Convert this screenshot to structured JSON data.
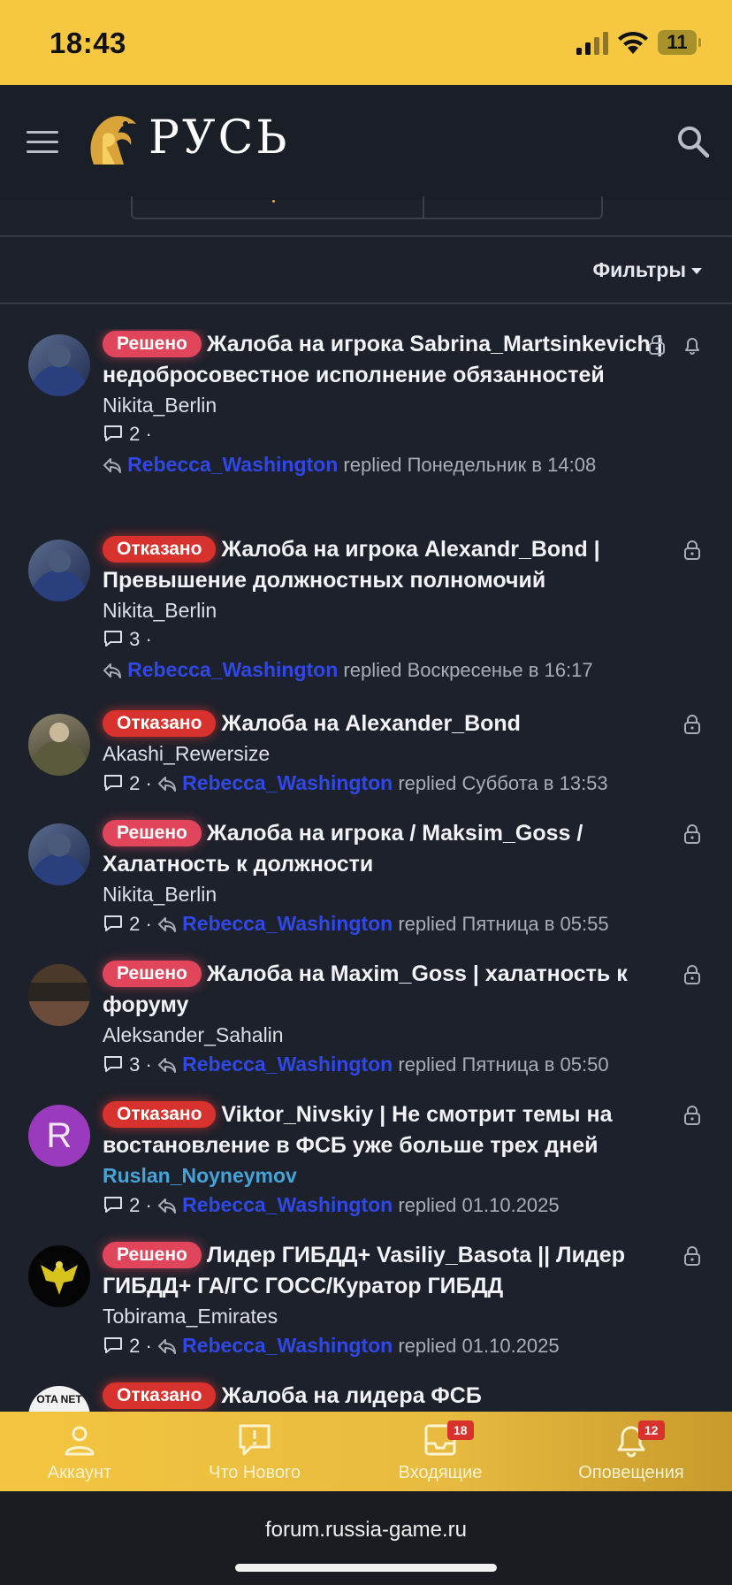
{
  "status_bar": {
    "time": "18:43",
    "battery": "11"
  },
  "header": {
    "logo_text": "РУСЬ",
    "filters_label": "Фильтры"
  },
  "threads": [
    {
      "status": "Решено",
      "status_kind": "solved",
      "title": "Жалоба на игрока Sabrina_Martsinkevich | недобросовестное исполнение обязанностей",
      "author": "Nikita_Berlin",
      "replies": "2",
      "last_user": "Rebecca_Washington",
      "replied_word": "replied",
      "last_time": "Понедельник в 14:08",
      "icons": [
        "lock-icon",
        "bell-icon"
      ]
    },
    {
      "status": "Отказано",
      "status_kind": "denied",
      "title": "Жалоба на игрока Alexandr_Bond | Превышение должностных полномочий",
      "author": "Nikita_Berlin",
      "replies": "3",
      "last_user": "Rebecca_Washington",
      "replied_word": "replied",
      "last_time": "Воскресенье в 16:17",
      "icons": [
        "lock-icon"
      ]
    },
    {
      "status": "Отказано",
      "status_kind": "denied",
      "title": "Жалоба на Alexander_Bond",
      "author": "Akashi_Rewersize",
      "replies": "2",
      "last_user": "Rebecca_Washington",
      "replied_word": "replied",
      "last_time": "Суббота в 13:53",
      "icons": [
        "lock-icon"
      ]
    },
    {
      "status": "Решено",
      "status_kind": "solved",
      "title": "Жалоба на игрока / Maksim_Goss / Халатность к должности",
      "author": "Nikita_Berlin",
      "replies": "2",
      "last_user": "Rebecca_Washington",
      "replied_word": "replied",
      "last_time": "Пятница в 05:55",
      "icons": [
        "lock-icon"
      ]
    },
    {
      "status": "Решено",
      "status_kind": "solved",
      "title": "Жалоба на Maxim_Goss | халатность к форуму",
      "author": "Aleksander_Sahalin",
      "replies": "3",
      "last_user": "Rebecca_Washington",
      "replied_word": "replied",
      "last_time": "Пятница в 05:50",
      "icons": [
        "lock-icon"
      ]
    },
    {
      "status": "Отказано",
      "status_kind": "denied",
      "title": "Viktor_Nivskiy | Не смотрит темы на востановление в ФСБ уже больше трех дней",
      "author": "Ruslan_Noyneymov",
      "avatar_letter": "R",
      "replies": "2",
      "last_user": "Rebecca_Washington",
      "replied_word": "replied",
      "last_time": "01.10.2025",
      "icons": [
        "lock-icon"
      ]
    },
    {
      "status": "Решено",
      "status_kind": "solved",
      "title": "Лидер ГИБДД+ Vasiliy_Basota || Лидер ГИБДД+ ГА/ГС ГОСС/Куратор ГИБДД",
      "author": "Tobirama_Emirates",
      "replies": "2",
      "last_user": "Rebecca_Washington",
      "replied_word": "replied",
      "last_time": "01.10.2025",
      "icons": [
        "lock-icon"
      ]
    },
    {
      "status": "Отказано",
      "status_kind": "denied",
      "title": "Жалоба на лидера ФСБ",
      "avatar_text": "OTA NET"
    }
  ],
  "tabbar": {
    "items": [
      {
        "label": "Аккаунт",
        "icon": "user-icon"
      },
      {
        "label": "Что Нового",
        "icon": "alert-message-icon"
      },
      {
        "label": "Входящие",
        "icon": "inbox-icon",
        "badge": "18"
      },
      {
        "label": "Оповещения",
        "icon": "bell-icon",
        "badge": "12"
      }
    ]
  },
  "browser": {
    "url": "forum.russia-game.ru"
  }
}
